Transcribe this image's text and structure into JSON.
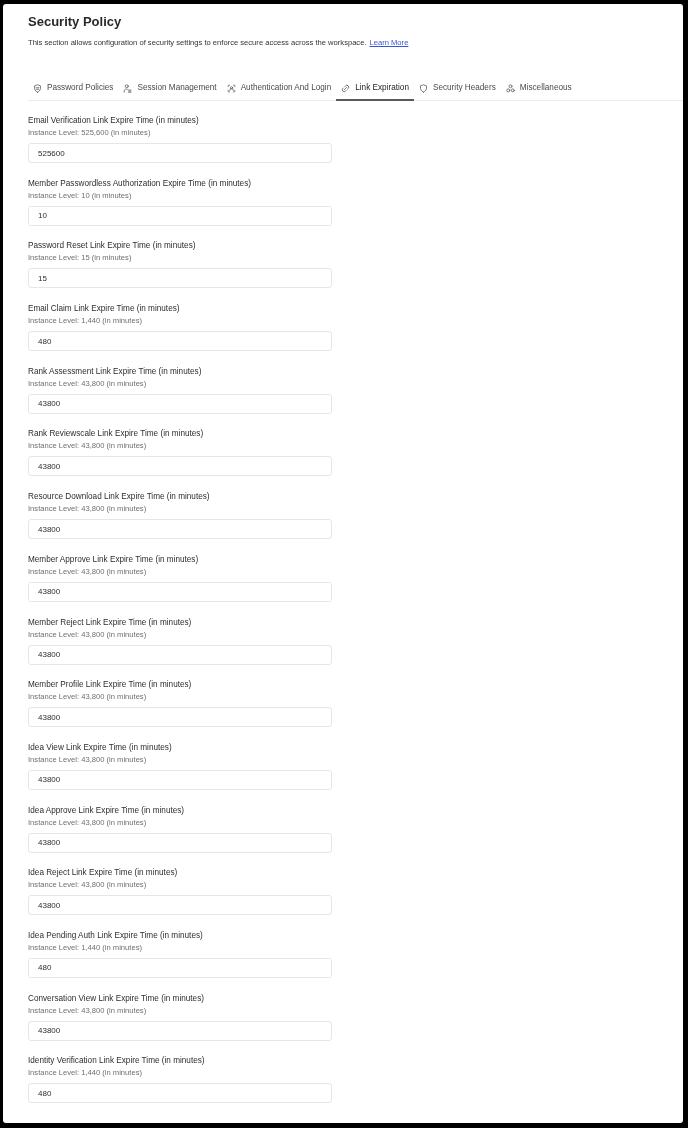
{
  "header": {
    "title": "Security Policy",
    "description": "This section allows configuration of security settings to enforce secure access across the workspace.",
    "link": "Learn More"
  },
  "tabs": [
    {
      "label": "Password Policies",
      "selected": false
    },
    {
      "label": "Session Management",
      "selected": false
    },
    {
      "label": "Authentication And Login",
      "selected": false
    },
    {
      "label": "Link Expiration",
      "selected": true
    },
    {
      "label": "Security Headers",
      "selected": false
    },
    {
      "label": "Miscellaneous",
      "selected": false
    }
  ],
  "fields": [
    {
      "label": "Email Verification Link Expire Time (in minutes)",
      "hint": "Instance Level: 525,600 (in minutes)",
      "value": "525600"
    },
    {
      "label": "Member Passwordless Authorization Expire Time (in minutes)",
      "hint": "Instance Level: 10 (in minutes)",
      "value": "10"
    },
    {
      "label": "Password Reset Link Expire Time (in minutes)",
      "hint": "Instance Level: 15 (in minutes)",
      "value": "15"
    },
    {
      "label": "Email Claim Link Expire Time (in minutes)",
      "hint": "Instance Level: 1,440 (in minutes)",
      "value": "480"
    },
    {
      "label": "Rank Assessment Link Expire Time (in minutes)",
      "hint": "Instance Level: 43,800 (in minutes)",
      "value": "43800"
    },
    {
      "label": "Rank Reviewscale Link Expire Time (in minutes)",
      "hint": "Instance Level: 43,800 (in minutes)",
      "value": "43800"
    },
    {
      "label": "Resource Download Link Expire Time (in minutes)",
      "hint": "Instance Level: 43,800 (in minutes)",
      "value": "43800"
    },
    {
      "label": "Member Approve Link Expire Time (in minutes)",
      "hint": "Instance Level: 43,800 (in minutes)",
      "value": "43800"
    },
    {
      "label": "Member Reject Link Expire Time (in minutes)",
      "hint": "Instance Level: 43,800 (in minutes)",
      "value": "43800"
    },
    {
      "label": "Member Profile Link Expire Time (in minutes)",
      "hint": "Instance Level: 43,800 (in minutes)",
      "value": "43800"
    },
    {
      "label": "Idea View Link Expire Time (in minutes)",
      "hint": "Instance Level: 43,800 (in minutes)",
      "value": "43800"
    },
    {
      "label": "Idea Approve Link Expire Time (in minutes)",
      "hint": "Instance Level: 43,800 (in minutes)",
      "value": "43800"
    },
    {
      "label": "Idea Reject Link Expire Time (in minutes)",
      "hint": "Instance Level: 43,800 (in minutes)",
      "value": "43800"
    },
    {
      "label": "Idea Pending Auth Link Expire Time (in minutes)",
      "hint": "Instance Level: 1,440 (in minutes)",
      "value": "480"
    },
    {
      "label": "Conversation View Link Expire Time (in minutes)",
      "hint": "Instance Level: 43,800 (in minutes)",
      "value": "43800"
    },
    {
      "label": "Identity Verification Link Expire Time (in minutes)",
      "hint": "Instance Level: 1,440 (in minutes)",
      "value": "480"
    }
  ]
}
